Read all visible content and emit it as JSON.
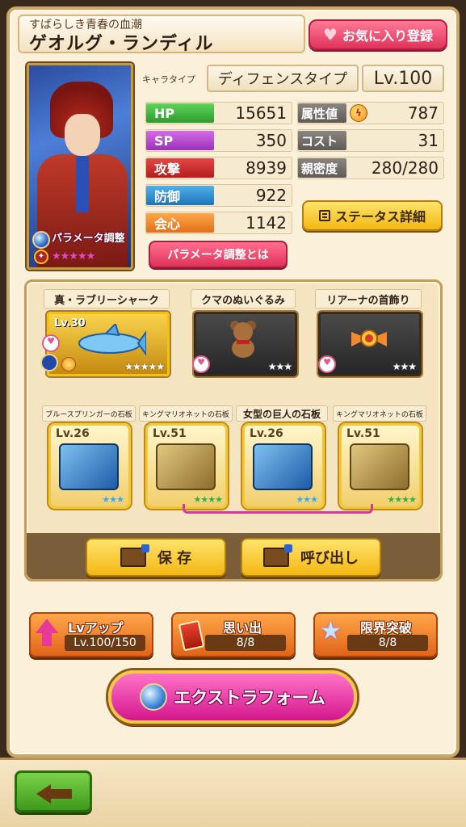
{
  "header": {
    "subtitle": "すばらしき青春の血潮",
    "name": "ゲオルグ・ランディル",
    "favorite_label": "お気に入り登録"
  },
  "portrait": {
    "param_tag": "パラメータ調整",
    "rarity_stars": "★★★★★"
  },
  "type": {
    "label": "キャラタイプ",
    "value": "ディフェンスタイプ"
  },
  "level": "Lv.100",
  "stats_left": [
    {
      "label": "HP",
      "value": "15651",
      "color": "green"
    },
    {
      "label": "SP",
      "value": "350",
      "color": "purple"
    },
    {
      "label": "攻撃",
      "value": "8939",
      "color": "red"
    },
    {
      "label": "防御",
      "value": "922",
      "color": "blue"
    },
    {
      "label": "会心",
      "value": "1142",
      "color": "orange"
    }
  ],
  "stats_right": [
    {
      "label": "属性値",
      "value": "787",
      "icon": "lightning-element-icon"
    },
    {
      "label": "コスト",
      "value": "31"
    },
    {
      "label": "親密度",
      "value": "280/280"
    }
  ],
  "buttons": {
    "status_detail": "ステータス詳細",
    "param_about": "パラメータ調整とは",
    "save": "保 存",
    "recall": "呼び出し"
  },
  "equipment": [
    {
      "name": "真・ラブリーシャーク",
      "level": "Lv.30",
      "stars": "★★★★★"
    },
    {
      "name": "クマのぬいぐるみ",
      "stars": "★★★"
    },
    {
      "name": "リアーナの首飾り",
      "stars": "★★★"
    }
  ],
  "stones": [
    {
      "name": "ブルースプリンガーの石板",
      "level": "Lv.26",
      "stars": "★★★",
      "style": "blue"
    },
    {
      "name": "キングマリオネットの石板",
      "level": "Lv.51",
      "stars": "★★★★",
      "style": "bronze"
    },
    {
      "name": "女型の巨人の石板",
      "level": "Lv.26",
      "stars": "★★★",
      "style": "blue"
    },
    {
      "name": "キングマリオネットの石板",
      "level": "Lv.51",
      "stars": "★★★★",
      "style": "bronze"
    }
  ],
  "actions": {
    "levelup": {
      "title": "Lvアップ",
      "sub": "Lv.100/150"
    },
    "memories": {
      "title": "思い出",
      "sub": "8/8"
    },
    "limit_break": {
      "title": "限界突破",
      "sub": "8/8"
    }
  },
  "extra_form": "エクストラフォーム"
}
